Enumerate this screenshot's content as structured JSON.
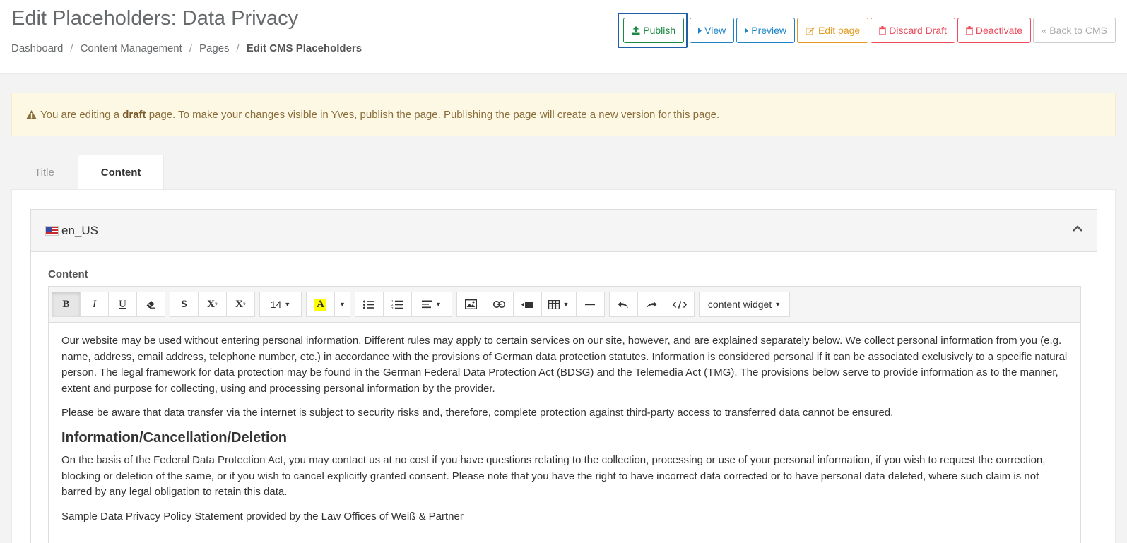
{
  "header": {
    "title": "Edit Placeholders: Data Privacy",
    "breadcrumb": [
      "Dashboard",
      "Content Management",
      "Pages",
      "Edit CMS Placeholders"
    ],
    "separator": "/"
  },
  "actions": {
    "publish": "Publish",
    "view": "View",
    "preview": "Preview",
    "edit_page": "Edit page",
    "discard_draft": "Discard Draft",
    "deactivate": "Deactivate",
    "back_to_cms": "Back to CMS"
  },
  "alert": {
    "pre": "You are editing a",
    "bold": "draft",
    "post": "page. To make your changes visible in Yves, publish the page. Publishing the page will create a new version for this page."
  },
  "tabs": [
    "Title",
    "Content"
  ],
  "locale": "en_US",
  "editor": {
    "label": "Content",
    "font_size": "14",
    "widget_dropdown": "content widget",
    "paragraphs": [
      "Our website may be used without entering personal information. Different rules may apply to certain services on our site, however, and are explained separately below. We collect personal information from you (e.g. name, address, email address, telephone number, etc.) in accordance with the provisions of German data protection statutes. Information is considered personal if it can be associated exclusively to a specific natural person. The legal framework for data protection may be found in the German Federal Data Protection Act (BDSG) and the Telemedia Act (TMG). The provisions below serve to provide information as to the manner, extent and purpose for collecting, using and processing personal information by the provider.",
      "Please be aware that data transfer via the internet is subject to security risks and, therefore, complete protection against third-party access to transferred data cannot be ensured."
    ],
    "heading": "Information/Cancellation/Deletion",
    "paragraphs_after": [
      "On the basis of the Federal Data Protection Act, you may contact us at no cost if you have questions relating to the collection, processing or use of your personal information, if you wish to request the correction, blocking or deletion of the same, or if you wish to cancel explicitly granted consent. Please note that you have the right to have incorrect data corrected or to have personal data deleted, where such claim is not barred by any legal obligation to retain this data.",
      "Sample Data Privacy Policy Statement provided by the Law Offices of Weiß & Partner"
    ]
  },
  "colors": {
    "publish": "#1a8a42",
    "blue": "#1c84c6",
    "orange": "#e59a1d",
    "red": "#ed4a5a",
    "alert_bg": "#fcf8e3"
  }
}
